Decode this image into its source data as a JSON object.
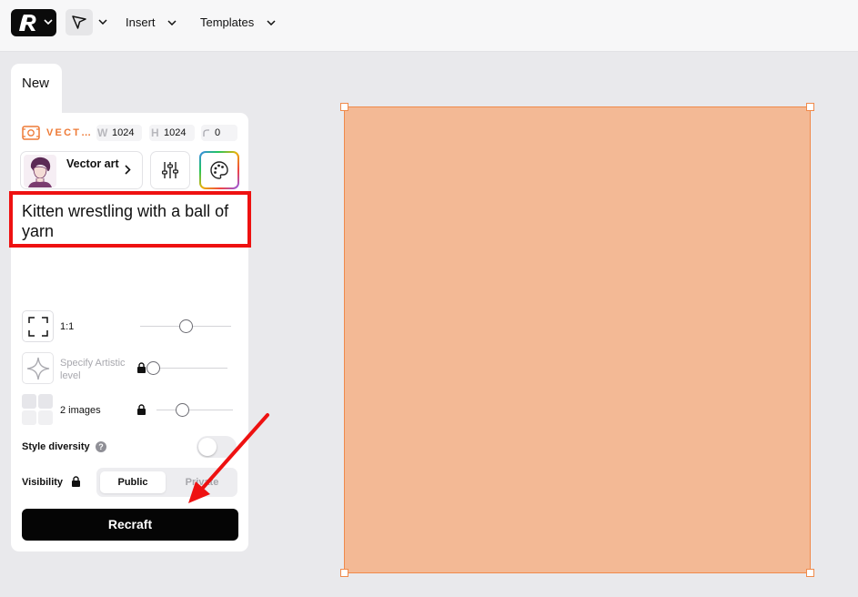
{
  "toolbar": {
    "insert_label": "Insert",
    "templates_label": "Templates"
  },
  "new_tab": {
    "label": "New"
  },
  "style": {
    "name": "VECT…",
    "width_label": "W",
    "width_value": "1024",
    "height_label": "H",
    "height_value": "1024",
    "seed_value": "0"
  },
  "model": {
    "label": "Vector art"
  },
  "prompt": {
    "text": "Kitten wrestling with a ball of yarn"
  },
  "options": {
    "aspect_ratio_label": "1:1",
    "aspect_ratio_level": 0.5,
    "artistic_label": "Specify Artistic level",
    "artistic_level": 0.0,
    "images_label": "2 images",
    "images_level": 0.33
  },
  "style_diversity": {
    "label": "Style diversity",
    "help_glyph": "?",
    "enabled": false
  },
  "visibility": {
    "label": "Visibility",
    "public_label": "Public",
    "private_label": "Private",
    "selected": "Public"
  },
  "recraft_button": {
    "label": "Recraft"
  },
  "canvas": {
    "fill_color": "#f3b995",
    "border_color": "#f08a4b"
  },
  "annotations": {
    "highlight_color": "#ee1111",
    "arrow_color": "#ee1111"
  }
}
